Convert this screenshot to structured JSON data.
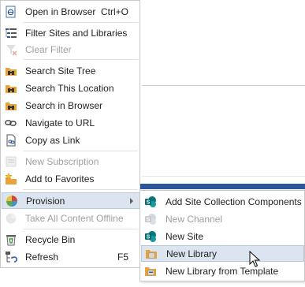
{
  "menu": {
    "items": [
      {
        "label": "Open in Browser",
        "shortcut": "Ctrl+O",
        "icon": "open-in-browser-icon",
        "enabled": true
      },
      {
        "label": "Filter Sites and Libraries",
        "icon": "filter-list-icon",
        "enabled": true
      },
      {
        "label": "Clear Filter",
        "icon": "clear-filter-icon",
        "enabled": false
      },
      {
        "label": "Search Site Tree",
        "icon": "binoculars-folder-icon",
        "enabled": true
      },
      {
        "label": "Search This Location",
        "icon": "binoculars-folder-icon",
        "enabled": true
      },
      {
        "label": "Search in Browser",
        "icon": "binoculars-folder-icon",
        "enabled": true
      },
      {
        "label": "Navigate to URL",
        "icon": "link-chain-icon",
        "enabled": true
      },
      {
        "label": "Copy as Link",
        "icon": "copy-link-icon",
        "enabled": true
      },
      {
        "label": "New Subscription",
        "icon": "subscription-icon",
        "enabled": false
      },
      {
        "label": "Add to Favorites",
        "icon": "star-folder-icon",
        "enabled": true
      },
      {
        "label": "Provision",
        "icon": "provision-pie-icon",
        "enabled": true,
        "has_submenu": true
      },
      {
        "label": "Take All Content Offline",
        "icon": "offline-icon",
        "enabled": false
      },
      {
        "label": "Recycle Bin",
        "icon": "recycle-bin-icon",
        "enabled": true
      },
      {
        "label": "Refresh",
        "shortcut": "F5",
        "icon": "refresh-tree-icon",
        "enabled": true
      }
    ]
  },
  "submenu": {
    "items": [
      {
        "label": "Add Site Collection Components",
        "icon": "sharepoint-icon",
        "enabled": true
      },
      {
        "label": "New Channel",
        "icon": "sharepoint-icon",
        "enabled": false
      },
      {
        "label": "New Site",
        "icon": "sharepoint-icon",
        "enabled": true
      },
      {
        "label": "New Library",
        "icon": "new-library-icon",
        "enabled": true,
        "hovered": true
      },
      {
        "label": "New Library from Template",
        "icon": "new-library-template-icon",
        "enabled": true
      }
    ]
  },
  "colors": {
    "accent": "#2b579a",
    "hover_bg": "#dce4f0",
    "disabled_text": "#a0a0a0",
    "sharepoint_teal": "#038387",
    "folder_orange": "#e8a33d"
  }
}
